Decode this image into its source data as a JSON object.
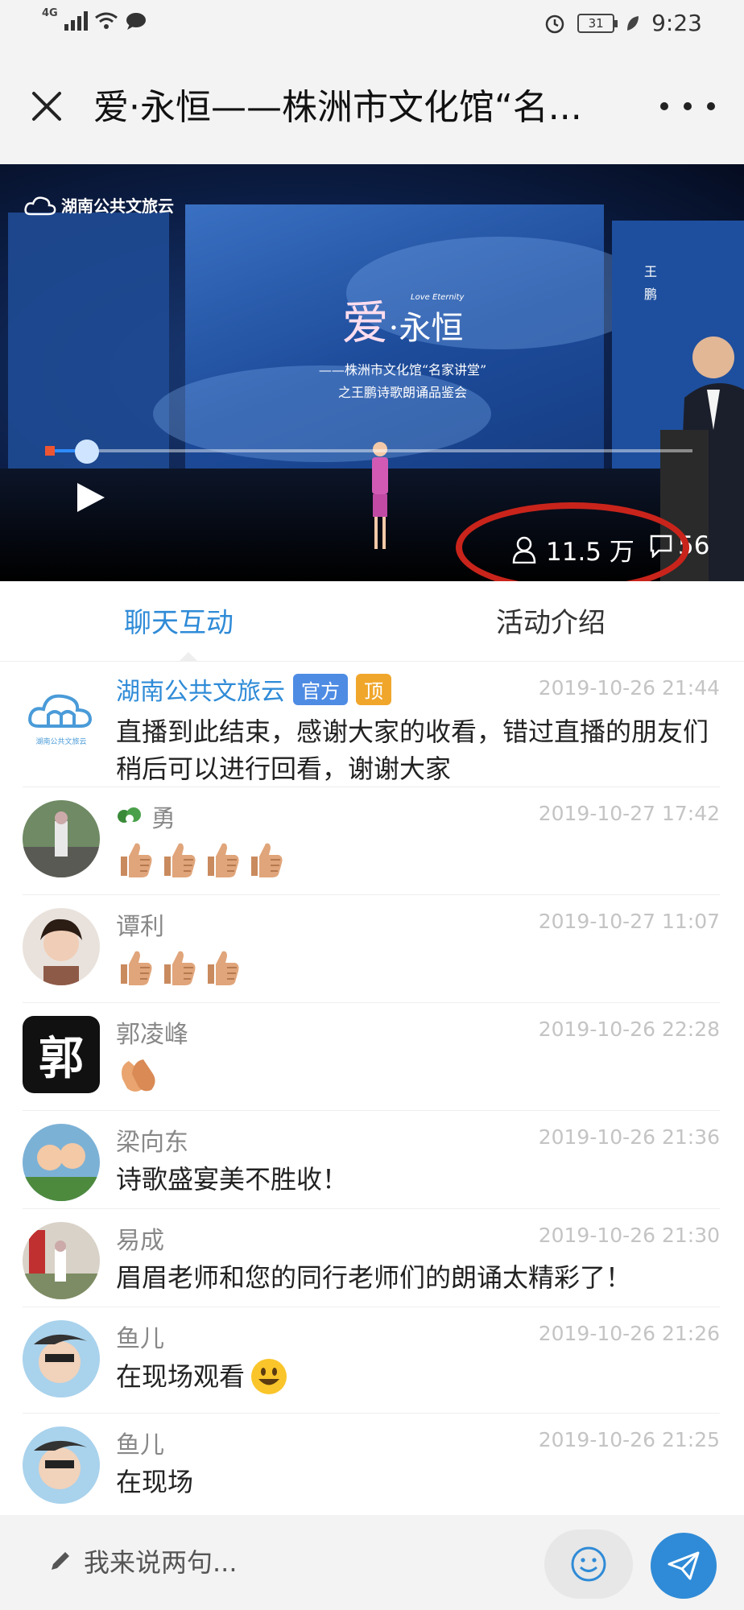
{
  "status_bar": {
    "network": "4G",
    "battery": "31",
    "time": "9:23"
  },
  "header": {
    "title": "爱·永恒——株洲市文化馆“名..."
  },
  "video": {
    "brand": "湖南公共文旅云",
    "stage_title_main": "爱",
    "stage_title_sub": "·永恒",
    "stage_title_en": "Love Eternity",
    "stage_line1": "——株洲市文化馆“名家讲堂”",
    "stage_line2": "之王鹏诗歌朗诵品鉴会",
    "speaker_name": "王鹏",
    "viewers": "11.5 万",
    "comments": "56",
    "progress": 0.06
  },
  "tabs": [
    {
      "label": "聊天互动",
      "active": true
    },
    {
      "label": "活动介绍",
      "active": false
    }
  ],
  "messages": [
    {
      "name": "湖南公共文旅云",
      "badge_official": "官方",
      "badge_top": "顶",
      "time": "2019-10-26 21:44",
      "text": "直播到此结束，感谢大家的收看，错过直播的朋友们稍后可以进行回看，谢谢大家",
      "avatar_label": "湖南公共文旅云"
    },
    {
      "name": "勇",
      "time": "2019-10-27 17:42",
      "thumbs": 4
    },
    {
      "name": "谭利",
      "time": "2019-10-27 11:07",
      "thumbs": 3
    },
    {
      "name": "郭凌峰",
      "time": "2019-10-26 22:28",
      "avatar_char": "郭",
      "clap": 1
    },
    {
      "name": "梁向东",
      "time": "2019-10-26 21:36",
      "text": "诗歌盛宴美不胜收！"
    },
    {
      "name": "易成",
      "time": "2019-10-26 21:30",
      "text": "眉眉老师和您的同行老师们的朗诵太精彩了！"
    },
    {
      "name": "鱼儿",
      "time": "2019-10-26 21:26",
      "text": "在现场观看"
    },
    {
      "name": "鱼儿",
      "time": "2019-10-26 21:25",
      "text": "在现场"
    }
  ],
  "input": {
    "placeholder": "我来说两句..."
  },
  "colors": {
    "accent": "#2f8bd7",
    "highlight": "#c9241b",
    "badge_official": "#4e8ce4",
    "badge_top": "#f0a62b"
  }
}
